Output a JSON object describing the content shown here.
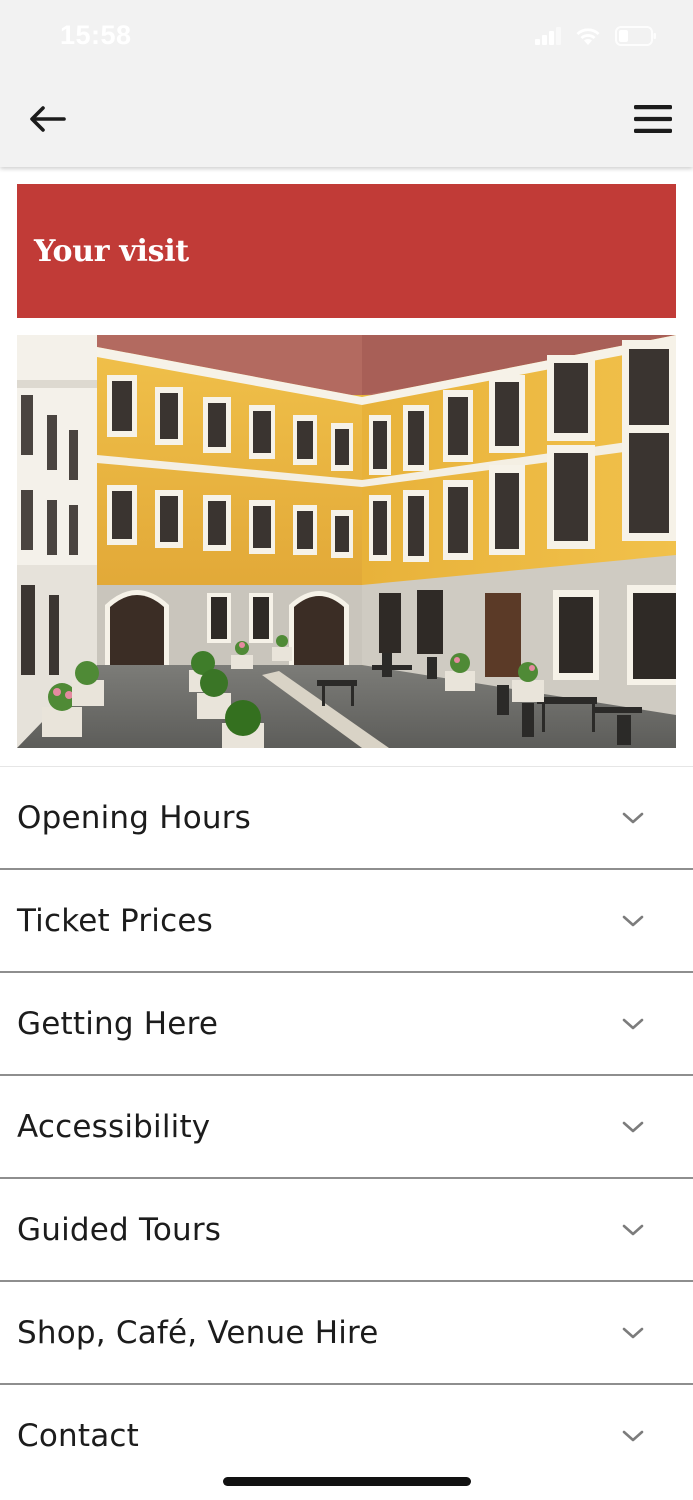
{
  "status_bar": {
    "time": "15:58",
    "icons": [
      "signal-icon",
      "wifi-icon",
      "battery-icon"
    ]
  },
  "app_bar": {
    "back_icon": "arrow-left-icon",
    "menu_icon": "hamburger-menu-icon"
  },
  "banner": {
    "title": "Your visit",
    "color": "#c13b37"
  },
  "hero_image": {
    "subject": "courtyard-photo"
  },
  "accordion": {
    "chevron_icon": "chevron-down-icon",
    "items": [
      {
        "label": "Opening Hours"
      },
      {
        "label": "Ticket Prices"
      },
      {
        "label": "Getting Here"
      },
      {
        "label": "Accessibility"
      },
      {
        "label": "Guided Tours"
      },
      {
        "label": "Shop, Café, Venue Hire"
      },
      {
        "label": "Contact"
      }
    ]
  }
}
